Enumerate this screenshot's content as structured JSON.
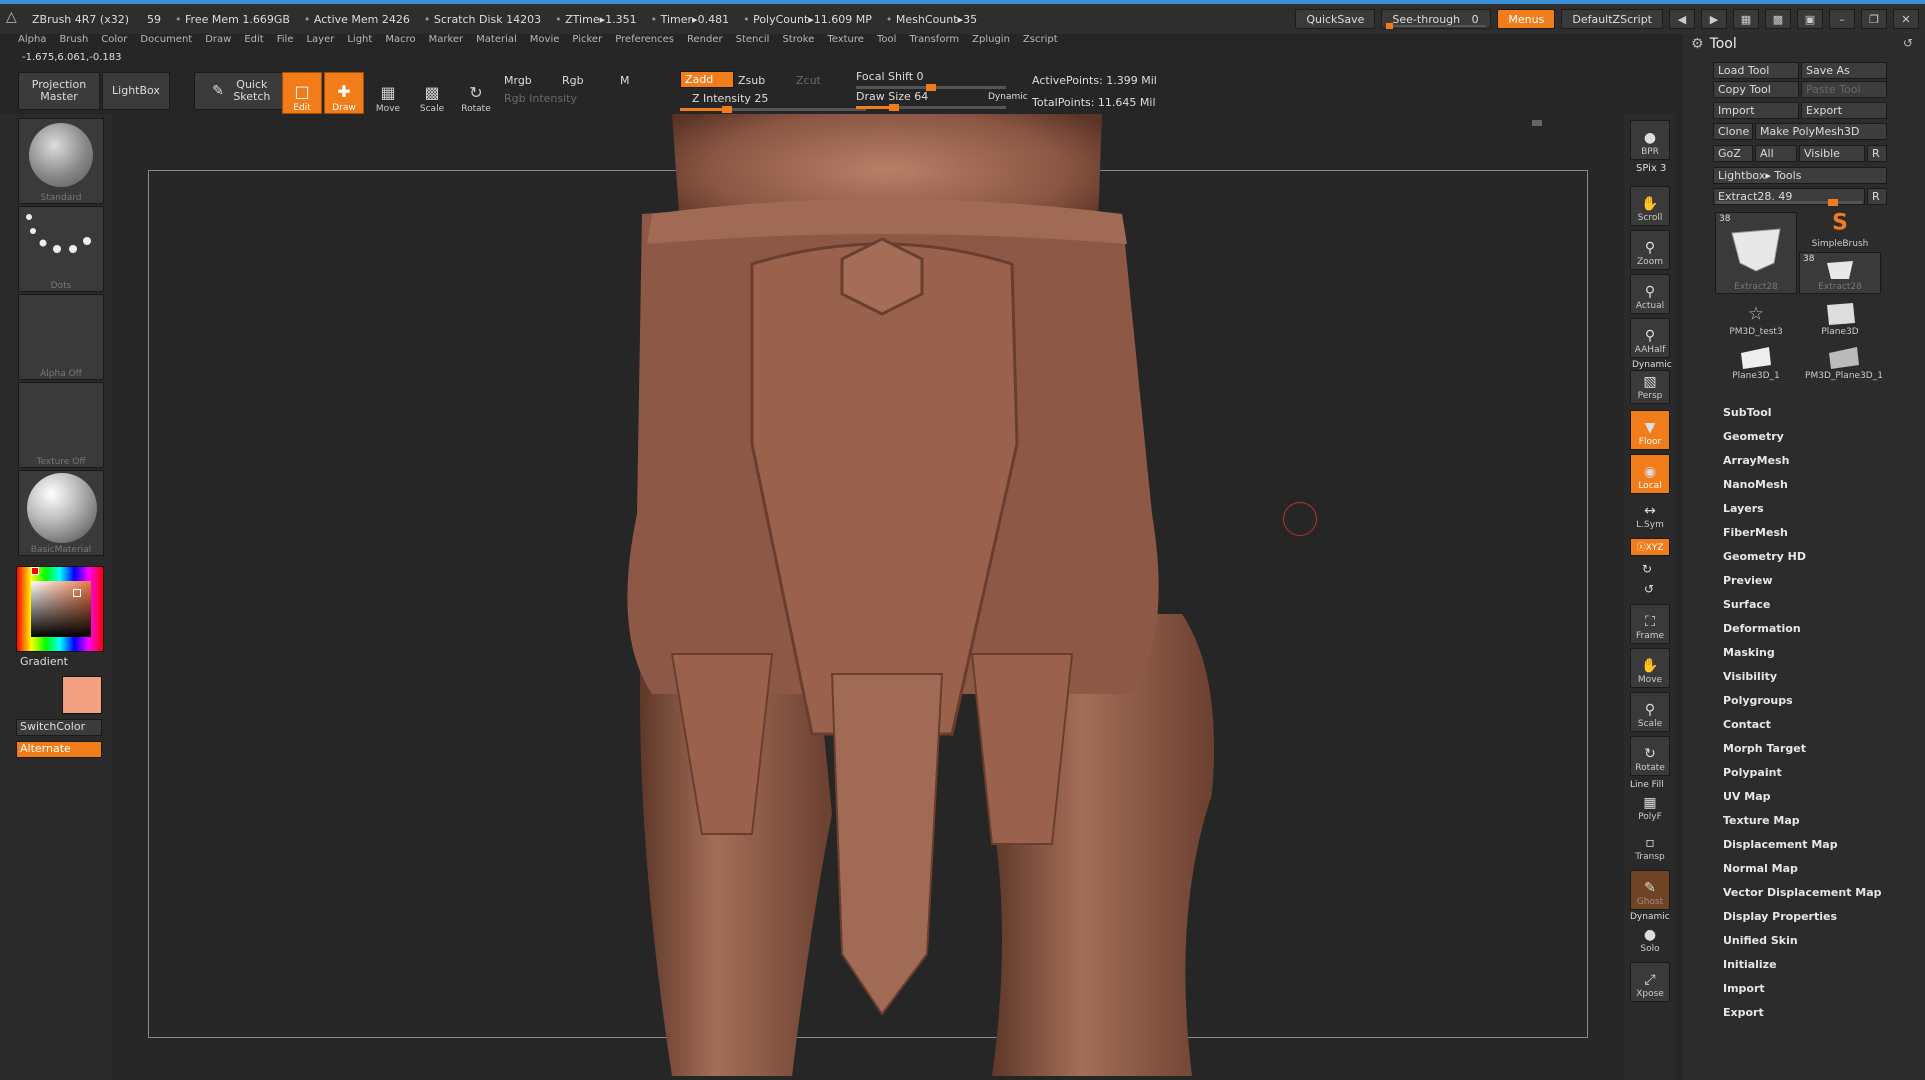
{
  "titlebar": {
    "app": "ZBrush 4R7 (x32)",
    "fps": "59",
    "stats": [
      "Free Mem 1.669GB",
      "Active Mem 2426",
      "Scratch Disk 14203",
      "ZTime▸1.351",
      "Timer▸0.481",
      "PolyCount▸11.609 MP",
      "MeshCount▸35"
    ],
    "quicksave": "QuickSave",
    "seethrough": "See-through",
    "seethrough_value": "0",
    "seethrough_level": 0,
    "menus": "Menus",
    "script": "DefaultZScript"
  },
  "menubar": [
    "Alpha",
    "Brush",
    "Color",
    "Document",
    "Draw",
    "Edit",
    "File",
    "Layer",
    "Light",
    "Macro",
    "Marker",
    "Material",
    "Movie",
    "Picker",
    "Preferences",
    "Render",
    "Stencil",
    "Stroke",
    "Texture",
    "Tool",
    "Transform",
    "Zplugin",
    "Zscript"
  ],
  "coords": "-1.675,6.061,-0.183",
  "toolbar": {
    "projection": "Projection Master",
    "lightbox": "LightBox",
    "quicksketch": "Quick Sketch",
    "edit": "Edit",
    "draw": "Draw",
    "move": "Move",
    "scale": "Scale",
    "rotate": "Rotate",
    "mrgb": "Mrgb",
    "rgb": "Rgb",
    "m": "M",
    "rgb_intensity": "Rgb Intensity",
    "zadd": "Zadd",
    "zsub": "Zsub",
    "zcut": "Zcut",
    "z_intensity": "Z Intensity 25",
    "z_intensity_level": 0.25,
    "focal_shift": "Focal Shift 0",
    "focal_shift_level": 0.5,
    "draw_size": "Draw Size 64",
    "draw_size_level": 0.25,
    "dynamic": "Dynamic",
    "active_points": "ActivePoints: 1.399  Mil",
    "total_points": "TotalPoints: 11.645  Mil"
  },
  "lefttray": {
    "brush": "Standard",
    "stroke": "Dots",
    "alpha": "Alpha  Off",
    "texture": "Texture  Off",
    "material": "BasicMaterial",
    "gradient": "Gradient",
    "switchcolor": "SwitchColor",
    "alternate": "Alternate"
  },
  "righttray": {
    "bpr": "BPR",
    "spix": "SPix 3",
    "scroll": "Scroll",
    "zoom": "Zoom",
    "actual": "Actual",
    "aahalf": "AAHalf",
    "dynamic": "Dynamic",
    "persp": "Persp",
    "floor": "Floor",
    "local": "Local",
    "lsym": "L.Sym",
    "xyz": "ⓧXYZ",
    "frame": "Frame",
    "move": "Move",
    "scale": "Scale",
    "rotate": "Rotate",
    "linefill": "Line Fill",
    "polyf": "PolyF",
    "transp": "Transp",
    "ghost": "Ghost",
    "dynamic2": "Dynamic",
    "solo": "Solo",
    "xpose": "Xpose"
  },
  "toolpanel": {
    "title": "Tool",
    "load_tool": "Load Tool",
    "save_as": "Save As",
    "copy_tool": "Copy Tool",
    "paste_tool": "Paste Tool",
    "import": "Import",
    "export": "Export",
    "clone": "Clone",
    "make_polymesh": "Make PolyMesh3D",
    "goz": "GoZ",
    "all": "All",
    "visible": "Visible",
    "r": "R",
    "lightbox_tools": "Lightbox▸ Tools",
    "extract": "Extract28. 49",
    "extract_level": 0.8,
    "tools": [
      {
        "name": "Extract28",
        "count": "38"
      },
      {
        "name": "SimpleBrush",
        "count": ""
      },
      {
        "name": "Extract28",
        "count": "38"
      },
      {
        "name": "PM3D_test3",
        "count": ""
      },
      {
        "name": "Plane3D",
        "count": ""
      },
      {
        "name": "Plane3D_1",
        "count": ""
      },
      {
        "name": "PM3D_Plane3D_1",
        "count": ""
      }
    ],
    "sections": [
      "SubTool",
      "Geometry",
      "ArrayMesh",
      "NanoMesh",
      "Layers",
      "FiberMesh",
      "Geometry HD",
      "Preview",
      "Surface",
      "Deformation",
      "Masking",
      "Visibility",
      "Polygroups",
      "Contact",
      "Morph Target",
      "Polypaint",
      "UV Map",
      "Texture Map",
      "Displacement Map",
      "Normal Map",
      "Vector Displacement Map",
      "Display Properties",
      "Unified Skin",
      "Initialize",
      "Import",
      "Export"
    ]
  }
}
